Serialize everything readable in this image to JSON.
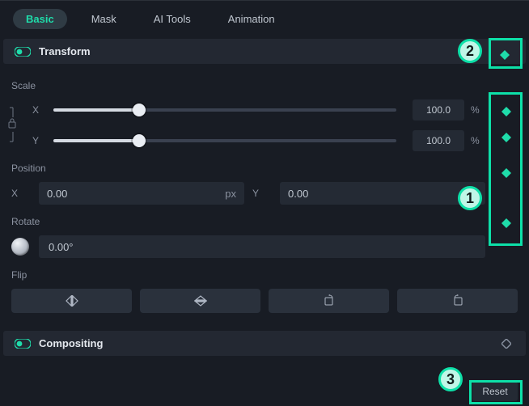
{
  "accent": "#1fdcaa",
  "tabs": {
    "basic": "Basic",
    "mask": "Mask",
    "ai": "AI Tools",
    "anim": "Animation"
  },
  "transform": {
    "title": "Transform",
    "scale": {
      "label": "Scale",
      "x_label": "X",
      "y_label": "Y",
      "x_val": "100.0",
      "y_val": "100.0",
      "unit": "%"
    },
    "position": {
      "label": "Position",
      "x_label": "X",
      "y_label": "Y",
      "x_val": "0.00",
      "y_val": "0.00",
      "unit": "px"
    },
    "rotate": {
      "label": "Rotate",
      "val": "0.00°"
    },
    "flip": {
      "label": "Flip"
    }
  },
  "compositing": {
    "title": "Compositing"
  },
  "reset": "Reset",
  "annotations": {
    "one": "1",
    "two": "2",
    "three": "3"
  }
}
